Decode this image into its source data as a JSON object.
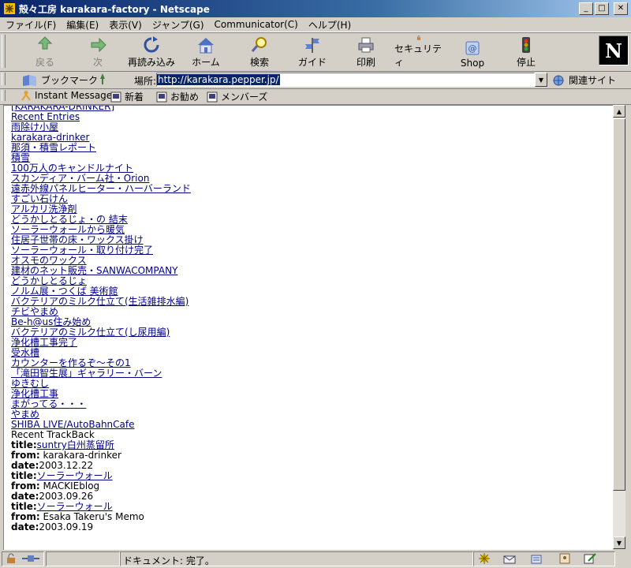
{
  "window": {
    "title": "殻々工房 karakara-factory - Netscape"
  },
  "menu": [
    "ファイル(F)",
    "編集(E)",
    "表示(V)",
    "ジャンプ(G)",
    "Communicator(C)",
    "ヘルプ(H)"
  ],
  "toolbar": {
    "back": "戻る",
    "forward": "次",
    "reload": "再読み込み",
    "home": "ホーム",
    "search": "検索",
    "guide": "ガイド",
    "print": "印刷",
    "security": "セキュリティ",
    "shop": "Shop",
    "stop": "停止"
  },
  "location": {
    "bookmarks_label": "ブックマーク",
    "label": "場所:",
    "url": "http://karakara.pepper.jp/",
    "related": "関連サイト"
  },
  "personal": {
    "instant_message": "Instant Message",
    "new": "新着",
    "recommend": "お勧め",
    "members": "メンバーズ"
  },
  "content": {
    "top_partial": "[KARAKARA-DRINKER]",
    "recent_entries_heading": "Recent Entries",
    "entries": [
      "雨除け小屋",
      "karakara-drinker",
      "那須・積雪レポート",
      "積雪",
      "100万人のキャンドルナイト",
      "スカンディア・バーム社・Orion",
      "遠赤外線パネルヒーター・ハーバーランド",
      "すごい石けん",
      "アルカリ洗浄剤",
      "どうかしとるじょ・の 結末",
      "ソーラーウォールから暖気",
      "住居子世帯の床・ワックス掛け",
      "ソーラーウォール・取り付け完了",
      "オスモのワックス",
      "建材のネット販売・SANWACOMPANY",
      "どうかしとるじょ",
      "ノルム展・つくば 美術館",
      "バクテリアのミルク仕立て(生活雑排水編)",
      "チビやまめ",
      "Be-h@us住み始め",
      "バクテリアのミルク仕立て(し尿用編)",
      "浄化槽工事完了",
      "受水槽",
      "カウンターを作るぞ〜その1",
      "「滝田智生展」ギャラリー・バーン",
      "ゆきむし",
      "浄化槽工事",
      "まがってる・・・",
      "やまめ",
      "SHIBA LIVE/AutoBahnCafe"
    ],
    "trackback_heading": "Recent TrackBack",
    "labels": {
      "title": "title:",
      "from": "from:",
      "date": "date:"
    },
    "trackbacks": [
      {
        "title": "suntry白州蒸留所",
        "from": "karakara-drinker",
        "date": "2003.12.22"
      },
      {
        "title": "ソーラーウォール",
        "from": "MACKIEblog",
        "date": "2003.09.26"
      },
      {
        "title": "ソーラーウォール",
        "from": "Esaka Takeru's Memo",
        "date": "2003.09.19"
      }
    ]
  },
  "status": {
    "text": "ドキュメント: 完了。"
  },
  "colors": {
    "link": "#00008b",
    "titlebar": "#0a246a",
    "chrome": "#d4d0c8"
  },
  "icons": [
    "back-icon",
    "forward-icon",
    "reload-icon",
    "home-icon",
    "search-icon",
    "guide-icon",
    "print-icon",
    "security-icon",
    "shop-icon",
    "stop-icon"
  ]
}
